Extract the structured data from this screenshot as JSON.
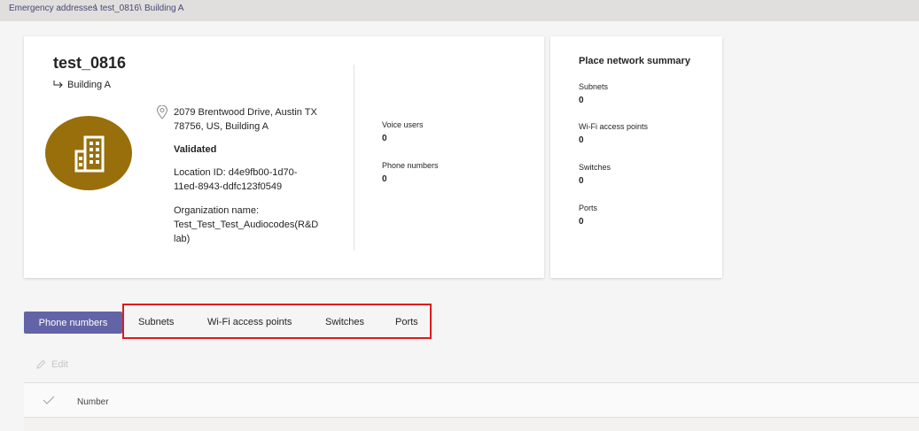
{
  "breadcrumb": {
    "item1": "Emergency addresses",
    "sep1": "\\",
    "item2": "test_0816",
    "sep2": "\\",
    "item3": "Building A"
  },
  "location": {
    "name": "test_0816",
    "place": "Building A",
    "address_line1": "2079 Brentwood Drive, Austin TX",
    "address_line2": "78756, US, Building A",
    "status": "Validated",
    "location_id_line1": "Location ID: d4e9fb00-1d70-",
    "location_id_line2": "11ed-8943-ddfc123f0549",
    "org_line1": "Organization name:",
    "org_line2": "Test_Test_Test_Audiocodes(R&D",
    "org_line3": "lab)"
  },
  "stats": {
    "voice_users_label": "Voice users",
    "voice_users_value": "0",
    "phone_numbers_label": "Phone numbers",
    "phone_numbers_value": "0"
  },
  "summary": {
    "title": "Place network summary",
    "subnets_label": "Subnets",
    "subnets_value": "0",
    "wifi_label": "Wi-Fi access points",
    "wifi_value": "0",
    "switches_label": "Switches",
    "switches_value": "0",
    "ports_label": "Ports",
    "ports_value": "0"
  },
  "tabs": {
    "active": "Phone numbers",
    "subnets": "Subnets",
    "wifi": "Wi-Fi access points",
    "switches": "Switches",
    "ports": "Ports"
  },
  "toolbar": {
    "edit_label": "Edit"
  },
  "table": {
    "column_number": "Number"
  },
  "colors": {
    "accent": "#6264a7",
    "avatar": "#986f0b",
    "highlight": "#e0191e"
  },
  "icons": {
    "building": "building-icon",
    "pin": "location-pin-icon",
    "edit": "pencil-icon",
    "check": "checkmark-icon",
    "subtitle": "return-arrow-icon"
  }
}
